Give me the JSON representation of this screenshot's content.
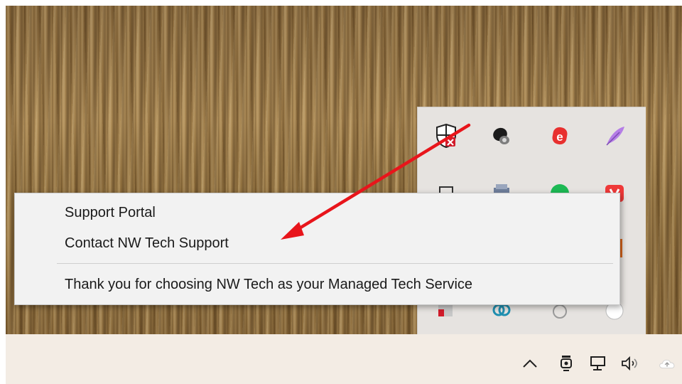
{
  "context_menu": {
    "items": [
      {
        "label": "Support Portal"
      },
      {
        "label": "Contact NW Tech Support"
      }
    ],
    "footer_text": "Thank you for choosing NW Tech as your Managed Tech Service"
  },
  "tray_flyout": {
    "icons": [
      "shield-security-icon",
      "audio-speaker-icon",
      "e-app-icon",
      "feather-icon",
      "puzzle-icon",
      "printer-icon",
      "spotify-icon",
      "vivaldi-icon",
      "app-icon",
      "ring-link-icon",
      "clock-icon",
      "wifi-badge-icon"
    ]
  },
  "taskbar": {
    "icons": [
      "chevron-up-icon",
      "webcam-icon",
      "network-icon",
      "volume-icon",
      "cloud-icon"
    ]
  },
  "colors": {
    "arrow": "#e8151b",
    "menu_bg": "#f2f2f2",
    "taskbar_bg": "#f3ece4"
  }
}
